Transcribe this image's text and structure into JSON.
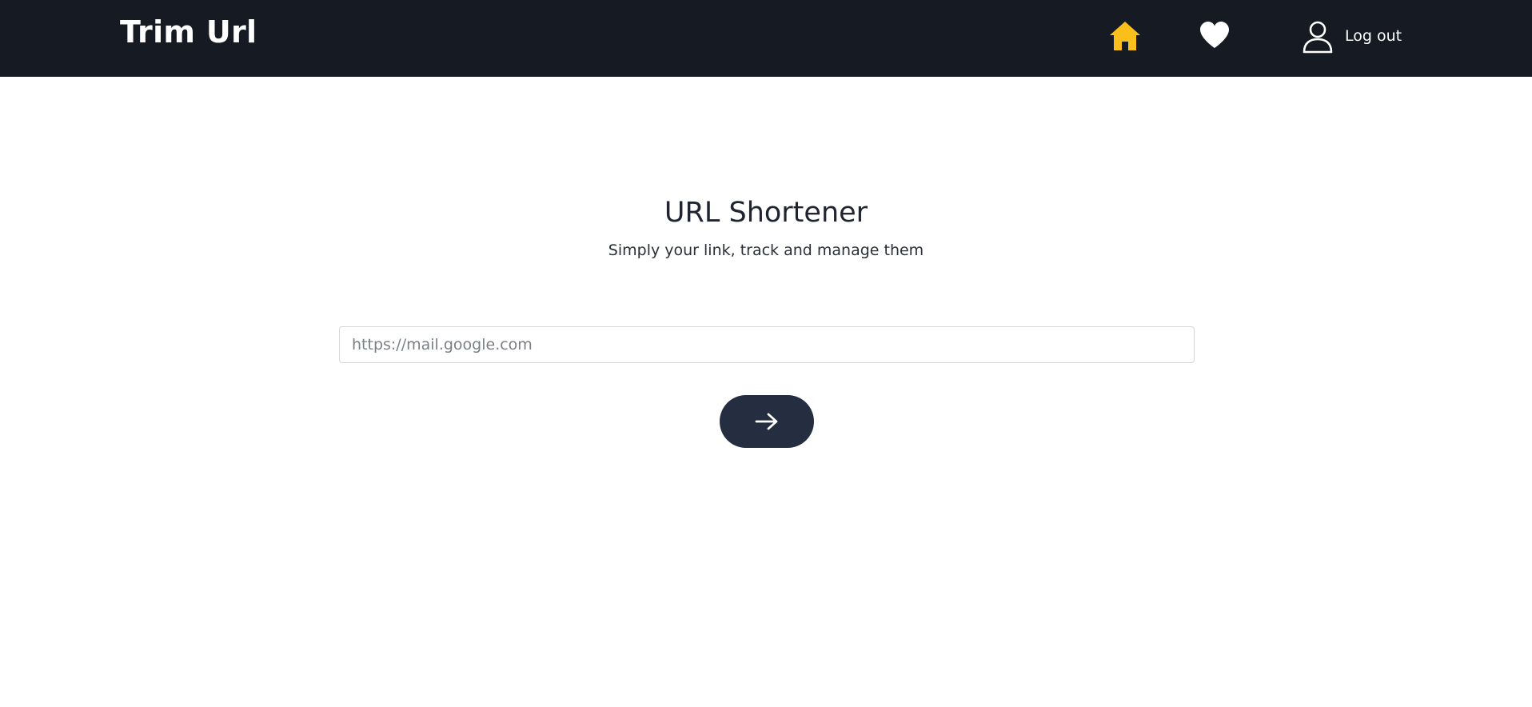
{
  "navbar": {
    "brand": "Trim Url",
    "home_icon": "home-icon",
    "favorites_icon": "heart-icon",
    "user_icon": "user-icon",
    "logout_label": "Log out",
    "colors": {
      "background": "#151a23",
      "home_active": "#fbbf1c",
      "icon": "#ffffff"
    }
  },
  "hero": {
    "title": "URL Shortener",
    "subtitle": "Simply your link, track and manage them"
  },
  "form": {
    "url_placeholder": "https://mail.google.com",
    "url_value": "",
    "submit_icon": "arrow-right-icon",
    "submit_color": "#242e40"
  }
}
